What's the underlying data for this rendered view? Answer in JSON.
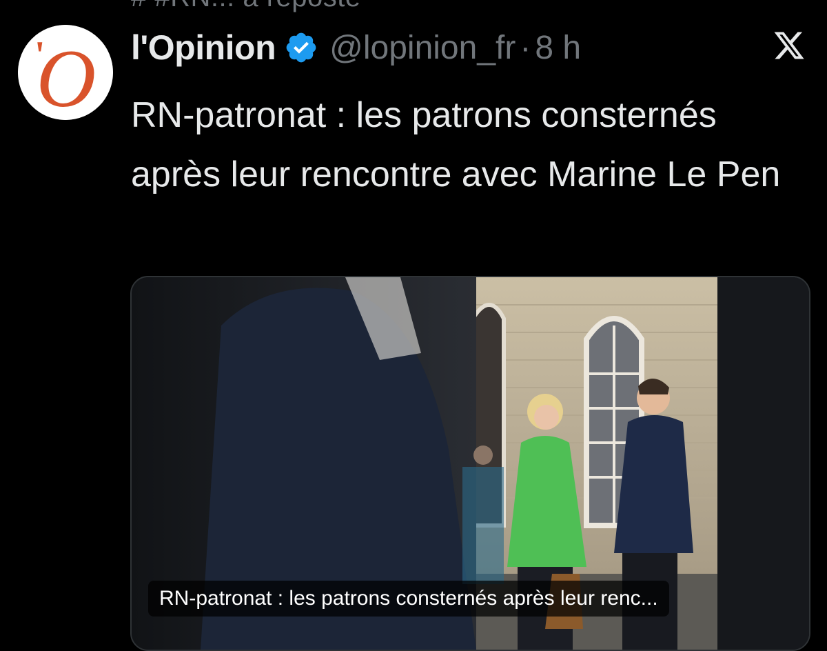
{
  "repost": {
    "text": "# #RN... a reposté"
  },
  "tweet": {
    "display_name": "l'Opinion",
    "verified_icon": "verified-badge-icon",
    "handle": "@lopinion_fr",
    "separator": "·",
    "time": "8 h",
    "text": "RN-patronat : les patrons consternés après leur rencontre avec Marine Le Pen",
    "avatar_letter": "O",
    "avatar_apostrophe": "'"
  },
  "media": {
    "caption": "RN-patronat : les patrons consternés après leur renc..."
  },
  "icons": {
    "avatar": "lopinion-logo",
    "verified": "verified-badge-icon",
    "more": "x-logo-icon"
  },
  "colors": {
    "background": "#000000",
    "text": "#e7e9ea",
    "muted": "#71767b",
    "verified_blue": "#1d9bf0",
    "logo_orange": "#d9532b"
  }
}
